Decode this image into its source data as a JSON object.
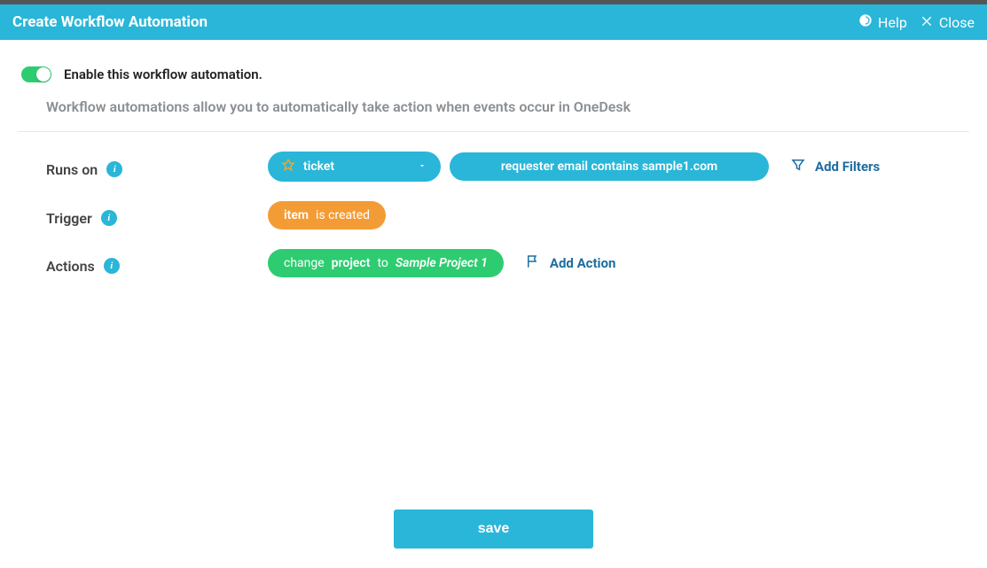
{
  "header": {
    "title": "Create Workflow Automation",
    "help_label": "Help",
    "close_label": "Close"
  },
  "enable": {
    "label": "Enable this workflow automation.",
    "on": true
  },
  "description": "Workflow automations allow you to automatically take action when events occur in OneDesk",
  "rows": {
    "runs_on": {
      "label": "Runs on",
      "type_label": "ticket",
      "filter_text": "requester email contains sample1.com",
      "add_filters_label": "Add Filters"
    },
    "trigger": {
      "label": "Trigger",
      "item_label": "item",
      "suffix": "is created"
    },
    "actions": {
      "label": "Actions",
      "prefix": "change",
      "field": "project",
      "mid": "to",
      "value": "Sample Project 1",
      "add_action_label": "Add Action"
    }
  },
  "buttons": {
    "save": "save"
  }
}
